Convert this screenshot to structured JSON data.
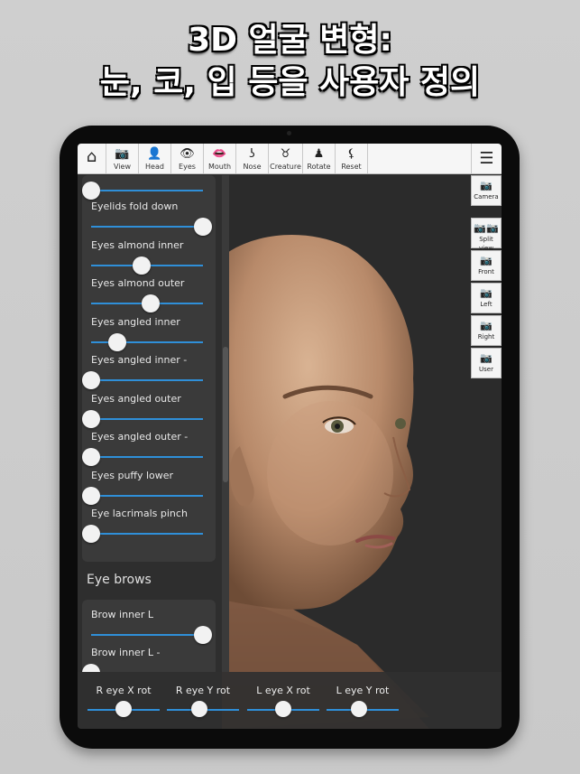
{
  "headline": {
    "line1": "3D 얼굴 변형:",
    "line2": "눈, 코, 입 등을 사용자 정의"
  },
  "toolbar": {
    "items": [
      {
        "icon": "camera-icon",
        "glyph": "📷",
        "label": "View"
      },
      {
        "icon": "head-icon",
        "glyph": "👤",
        "label": "Head"
      },
      {
        "icon": "eye-icon",
        "glyph": "👁",
        "label": "Eyes"
      },
      {
        "icon": "lips-icon",
        "glyph": "👄",
        "label": "Mouth"
      },
      {
        "icon": "nose-icon",
        "glyph": "ʖ",
        "label": "Nose"
      },
      {
        "icon": "creature-icon",
        "glyph": "♉",
        "label": "Creature"
      },
      {
        "icon": "rotate-icon",
        "glyph": "♟",
        "label": "Rotate"
      },
      {
        "icon": "reset-icon",
        "glyph": "⚸",
        "label": "Reset"
      }
    ],
    "home_glyph": "⌂",
    "menu_glyph": "☰"
  },
  "view_buttons": [
    {
      "label": "Camera"
    },
    {
      "label": "Split view"
    },
    {
      "label": "Front"
    },
    {
      "label": "Left"
    },
    {
      "label": "Right"
    },
    {
      "label": "User"
    }
  ],
  "eye_sliders": [
    {
      "label": "Eyelids fold down",
      "value": 1.0
    },
    {
      "label": "Eyes almond inner",
      "value": 0.45
    },
    {
      "label": "Eyes almond outer",
      "value": 0.53
    },
    {
      "label": "Eyes angled inner",
      "value": 0.23
    },
    {
      "label": "Eyes angled inner -",
      "value": 0.0
    },
    {
      "label": "Eyes angled outer",
      "value": 0.0
    },
    {
      "label": "Eyes angled outer -",
      "value": 0.0
    },
    {
      "label": "Eyes puffy lower",
      "value": 0.0
    },
    {
      "label": "Eye lacrimals pinch",
      "value": 0.0
    }
  ],
  "first_slider_value": 0.0,
  "eyebrows": {
    "title": "Eye brows",
    "sliders": [
      {
        "label": "Brow inner L",
        "value": 1.0
      },
      {
        "label": "Brow inner L -",
        "value": 0.0
      }
    ]
  },
  "bottom_sliders": [
    {
      "label": "R eye X rot",
      "value": 0.5
    },
    {
      "label": "R eye Y rot",
      "value": 0.45
    },
    {
      "label": "L eye X rot",
      "value": 0.5
    },
    {
      "label": "L eye Y rot",
      "value": 0.45
    }
  ]
}
